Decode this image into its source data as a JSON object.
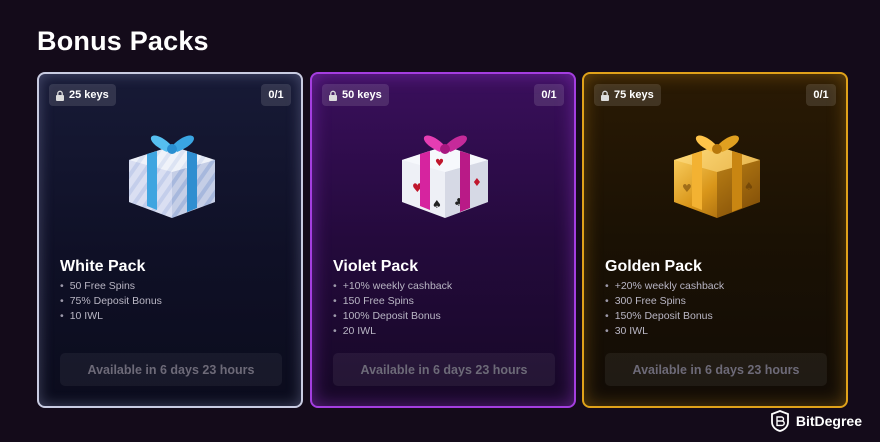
{
  "page": {
    "title": "Bonus Packs"
  },
  "packs": [
    {
      "id": "white",
      "keys": "25 keys",
      "count": "0/1",
      "name": "White Pack",
      "perks": [
        "50 Free Spins",
        "75% Deposit Bonus",
        "10 IWL"
      ],
      "button": "Available in 6 days 23 hours",
      "gift_icon": "gift-white-blue-ribbon-icon",
      "accent": "#c9cce2"
    },
    {
      "id": "violet",
      "keys": "50 keys",
      "count": "0/1",
      "name": "Violet Pack",
      "perks": [
        "+10% weekly cashback",
        "150 Free Spins",
        "100% Deposit Bonus",
        "20 IWL"
      ],
      "button": "Available in 6 days 23 hours",
      "gift_icon": "gift-cards-pink-ribbon-icon",
      "accent": "#a43ee0"
    },
    {
      "id": "golden",
      "keys": "75 keys",
      "count": "0/1",
      "name": "Golden Pack",
      "perks": [
        "+20% weekly cashback",
        "300 Free Spins",
        "150% Deposit Bonus",
        "30 IWL"
      ],
      "button": "Available in 6 days 23 hours",
      "gift_icon": "gift-golden-icon",
      "accent": "#e0a21a"
    }
  ],
  "watermark": {
    "text": "BitDegree",
    "icon": "bitdegree-logo-icon"
  }
}
